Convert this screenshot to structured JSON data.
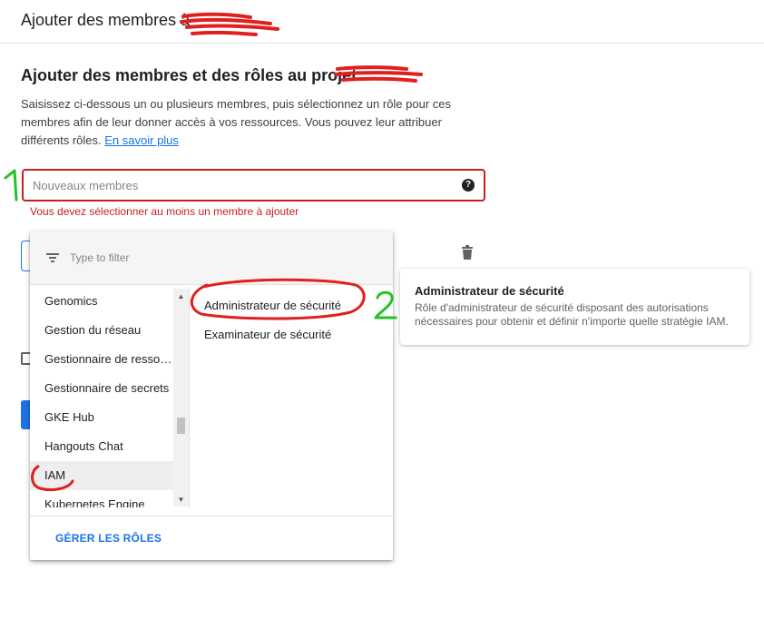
{
  "header": {
    "title": "Ajouter des membres à"
  },
  "section": {
    "title": "Ajouter des membres et des rôles au projet",
    "description": "Saisissez ci-dessous un ou plusieurs membres, puis sélectionnez un rôle pour ces membres afin de leur donner accès à vos ressources. Vous pouvez leur attribuer différents rôles.",
    "learn_more": "En savoir plus"
  },
  "members_field": {
    "placeholder": "Nouveaux membres",
    "error": "Vous devez sélectionner au moins un membre à ajouter"
  },
  "role_dropdown": {
    "filter_placeholder": "Type to filter",
    "services": [
      {
        "label": "Genomics",
        "selected": false
      },
      {
        "label": "Gestion du réseau",
        "selected": false
      },
      {
        "label": "Gestionnaire de ressources",
        "selected": false
      },
      {
        "label": "Gestionnaire de secrets",
        "selected": false
      },
      {
        "label": "GKE Hub",
        "selected": false
      },
      {
        "label": "Hangouts Chat",
        "selected": false
      },
      {
        "label": "IAM",
        "selected": true
      },
      {
        "label": "Kubernetes Engine",
        "selected": false
      }
    ],
    "roles": [
      {
        "label": "Administrateur de sécurité"
      },
      {
        "label": "Examinateur de sécurité"
      }
    ],
    "manage_roles": "GÉRER LES RÔLES"
  },
  "role_tooltip": {
    "title": "Administrateur de sécurité",
    "description": "Rôle d'administrateur de sécurité disposant des autorisations nécessaires pour obtenir et définir n'importe quelle stratégie IAM."
  },
  "annotations": {
    "step1": "1",
    "step2": "2",
    "colors": {
      "green": "#22c322",
      "red": "#e02020"
    }
  },
  "colors": {
    "accent": "#1a73e8",
    "error": "#c5221f"
  }
}
